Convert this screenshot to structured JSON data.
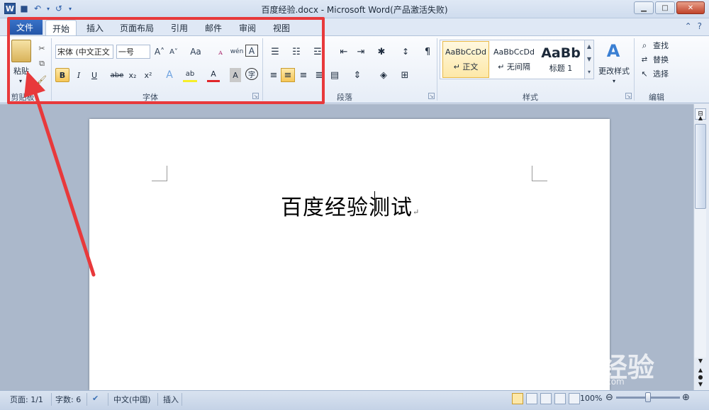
{
  "window": {
    "title": "百度经验.docx - Microsoft Word(产品激活失败)",
    "controls": {
      "minimize": "▁",
      "maximize": "□",
      "close": "✕"
    }
  },
  "qat": {
    "word_logo": "W",
    "save": "■",
    "undo": "↶",
    "redo": "↺"
  },
  "tabs": [
    {
      "label": "文件"
    },
    {
      "label": "开始"
    },
    {
      "label": "插入"
    },
    {
      "label": "页面布局"
    },
    {
      "label": "引用"
    },
    {
      "label": "邮件"
    },
    {
      "label": "审阅"
    },
    {
      "label": "视图"
    }
  ],
  "ribbon": {
    "clipboard": {
      "label": "剪贴板",
      "paste": "粘贴"
    },
    "font": {
      "label": "字体",
      "font_name": "宋体 (中文正文",
      "font_size": "一号",
      "bold": "B",
      "italic": "I",
      "underline": "U",
      "strike": "abe",
      "subscript": "x₂",
      "superscript": "x²",
      "grow": "A˄",
      "shrink": "A˅",
      "change_case": "Aa",
      "clear_format": "ꭺ",
      "phonetic": "wén",
      "char_border": "A",
      "text_effect": "A",
      "highlight": "ab",
      "font_color": "A",
      "char_shading": "A",
      "enclose": "字"
    },
    "paragraph": {
      "label": "段落"
    },
    "styles": {
      "label": "样式",
      "items": [
        {
          "preview": "AaBbCcDd",
          "name": "↵ 正文"
        },
        {
          "preview": "AaBbCcDd",
          "name": "↵ 无间隔"
        },
        {
          "preview": "AaBb",
          "name": "标题 1"
        }
      ],
      "change_styles": "更改样式"
    },
    "editing": {
      "label": "编辑",
      "find": "查找",
      "replace": "替换",
      "select": "选择"
    }
  },
  "document": {
    "text_before": "百度经验",
    "text_after": "测试",
    "para_mark": "↵"
  },
  "status": {
    "page": "页面: 1/1",
    "words": "字数: 6",
    "language": "中文(中国)",
    "mode": "插入",
    "zoom": "100%",
    "zoom_level": 1.0
  },
  "watermark": {
    "brand": "Bai 经验",
    "url": "jingyan.baidu.com"
  },
  "colors": {
    "accent": "#2b579a",
    "highlight_box": "#e8393b",
    "arrow": "#e8393b"
  }
}
